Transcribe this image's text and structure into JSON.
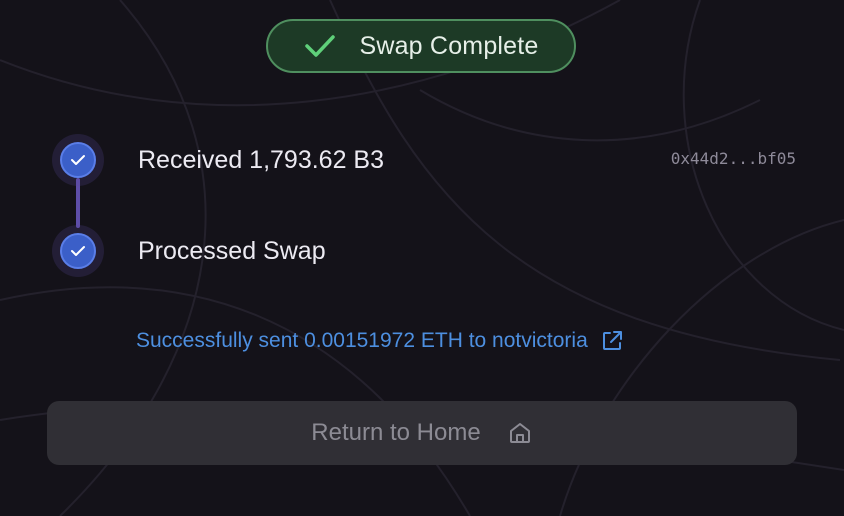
{
  "status": {
    "label": "Swap Complete",
    "icon": "check-icon",
    "color": "#4f8f5f"
  },
  "steps": [
    {
      "label": "Received 1,793.62 B3",
      "tx_hash": "0x44d2...bf05",
      "icon": "check-icon"
    },
    {
      "label": "Processed Swap",
      "icon": "check-icon"
    }
  ],
  "confirmation": {
    "text": "Successfully sent 0.00151972 ETH to notvictoria",
    "icon": "external-link-icon",
    "color": "#4d8fe0"
  },
  "home_button": {
    "label": "Return to Home",
    "icon": "home-icon"
  },
  "colors": {
    "background": "#141219",
    "step_accent": "#3b5fc8",
    "connector": "#5e4ea8"
  }
}
